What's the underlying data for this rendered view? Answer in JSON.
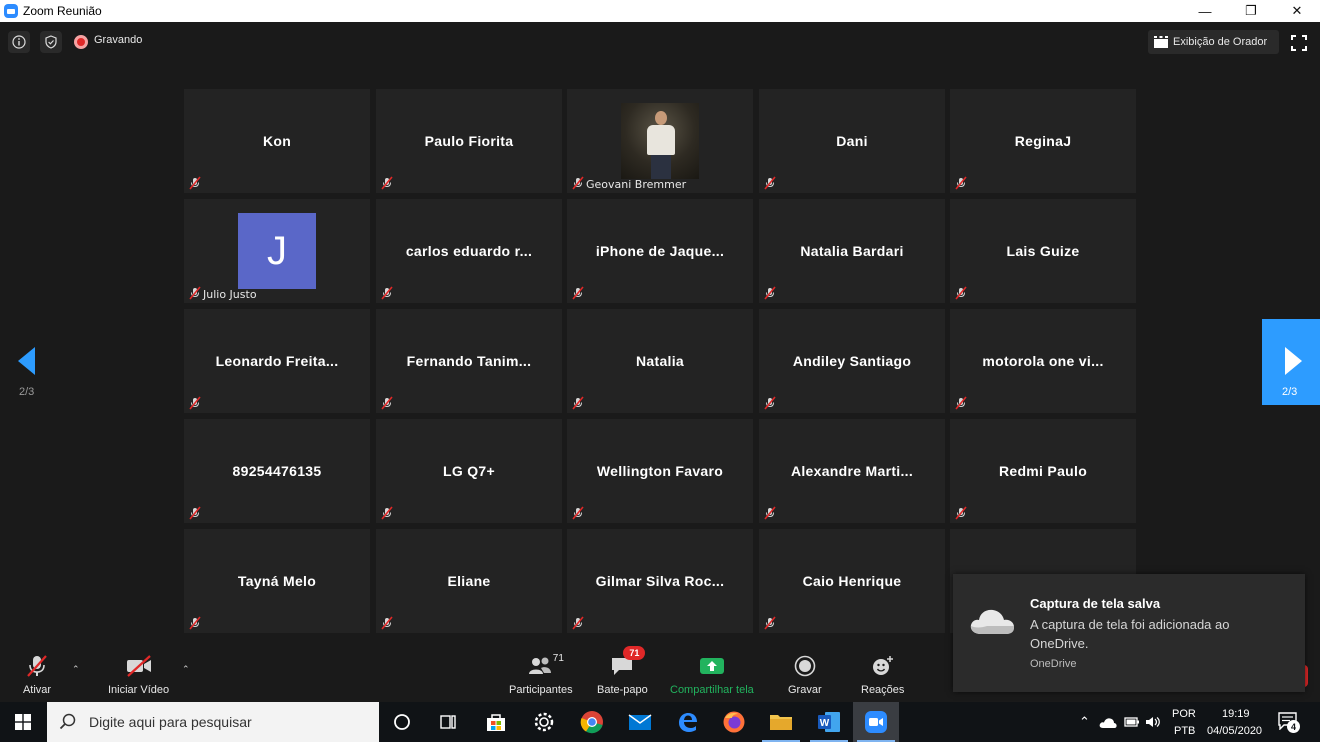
{
  "window": {
    "title": "Zoom Reunião",
    "minimize": "—",
    "restore": "❐",
    "close": "✕"
  },
  "topbar": {
    "recording_label": "Gravando",
    "view_button": "Exibição de Orador"
  },
  "tiles": [
    {
      "name": "Kon",
      "label_style": "center"
    },
    {
      "name": "Paulo Fiorita",
      "label_style": "center"
    },
    {
      "name": "Geovani Bremmer",
      "label_style": "tag",
      "video": "photo"
    },
    {
      "name": "Dani",
      "label_style": "center"
    },
    {
      "name": "ReginaJ",
      "label_style": "center"
    },
    {
      "name": "Julio Justo",
      "label_style": "tag",
      "avatar_letter": "J"
    },
    {
      "name": "carlos eduardo r...",
      "label_style": "center"
    },
    {
      "name": "iPhone de Jaque...",
      "label_style": "center"
    },
    {
      "name": "Natalia Bardari",
      "label_style": "center"
    },
    {
      "name": "Lais Guize",
      "label_style": "center"
    },
    {
      "name": "Leonardo Freita...",
      "label_style": "center"
    },
    {
      "name": "Fernando Tanim...",
      "label_style": "center"
    },
    {
      "name": "Natalia",
      "label_style": "center"
    },
    {
      "name": "Andiley Santiago",
      "label_style": "center"
    },
    {
      "name": "motorola one vi...",
      "label_style": "center"
    },
    {
      "name": "89254476135",
      "label_style": "center"
    },
    {
      "name": "LG Q7+",
      "label_style": "center"
    },
    {
      "name": "Wellington Favaro",
      "label_style": "center"
    },
    {
      "name": "Alexandre Marti...",
      "label_style": "center"
    },
    {
      "name": "Redmi Paulo",
      "label_style": "center"
    },
    {
      "name": "Tayná Melo",
      "label_style": "center"
    },
    {
      "name": "Eliane",
      "label_style": "center"
    },
    {
      "name": "Gilmar Silva Roc...",
      "label_style": "center"
    },
    {
      "name": "Caio Henrique",
      "label_style": "center"
    }
  ],
  "pagination": {
    "left_label": "2/3",
    "right_label": "2/3"
  },
  "controls": {
    "unmute": "Ativar",
    "start_video": "Iniciar Vídeo",
    "participants": "Participantes",
    "participants_count": "71",
    "chat": "Bate-papo",
    "chat_badge": "71",
    "share": "Compartilhar tela",
    "record": "Gravar",
    "reactions": "Reações"
  },
  "toast": {
    "title": "Captura de tela salva",
    "body": "A captura de tela foi adicionada ao OneDrive.",
    "app": "OneDrive"
  },
  "taskbar": {
    "search_placeholder": "Digite aqui para pesquisar",
    "lang_top": "POR",
    "lang_bottom": "PTB",
    "time": "19:19",
    "date": "04/05/2020",
    "notifications": "4"
  },
  "colors": {
    "accent": "#2d9cff",
    "share_green": "#22b35e",
    "alert_red": "#e02828"
  }
}
